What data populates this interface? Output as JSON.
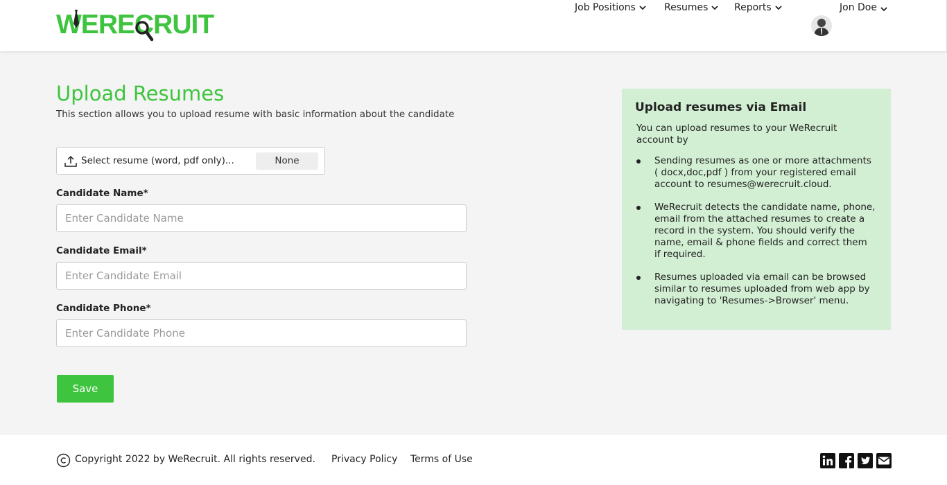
{
  "brand": {
    "logo_text_we": "WE",
    "logo_text_rest": "RECRUIT",
    "accent": "#3ec43e"
  },
  "nav": {
    "items": [
      {
        "label": "Job Positions"
      },
      {
        "label": "Resumes"
      },
      {
        "label": "Reports"
      }
    ],
    "user_name": "Jon Doe"
  },
  "main": {
    "title": "Upload Resumes",
    "subtitle": "This section allows you to upload resume with basic information about the candidate",
    "file_picker": {
      "label": "Select resume (word, pdf only)...",
      "status": "None"
    },
    "fields": [
      {
        "label": "Candidate Name*",
        "placeholder": "Enter Candidate Name",
        "value": ""
      },
      {
        "label": "Candidate Email*",
        "placeholder": "Enter Candidate Email",
        "value": ""
      },
      {
        "label": "Candidate Phone*",
        "placeholder": "Enter Candidate Phone",
        "value": ""
      }
    ],
    "save_label": "Save"
  },
  "info": {
    "title": "Upload resumes via Email",
    "intro": "You can upload resumes to your WeRecruit account by",
    "bullets": [
      "Sending resumes as one or more attachments ( docx,doc,pdf ) from your registered email account to resumes@werecruit.cloud.",
      "WeRecruit detects the candidate name, phone, email from the attached resumes to create a record in the system. You should verify the name, email & phone fields and correct them if required.",
      "Resumes uploaded via email can be browsed similar to resumes uploaded from web app by navigating to 'Resumes->Browser' menu."
    ],
    "background": "#d2efd3"
  },
  "footer": {
    "copyright": "Copyright 2022 by WeRecruit. All rights reserved.",
    "privacy": "Privacy Policy",
    "terms": "Terms of Use",
    "social_icons": [
      "linkedin-icon",
      "facebook-icon",
      "twitter-icon",
      "email-icon"
    ]
  }
}
